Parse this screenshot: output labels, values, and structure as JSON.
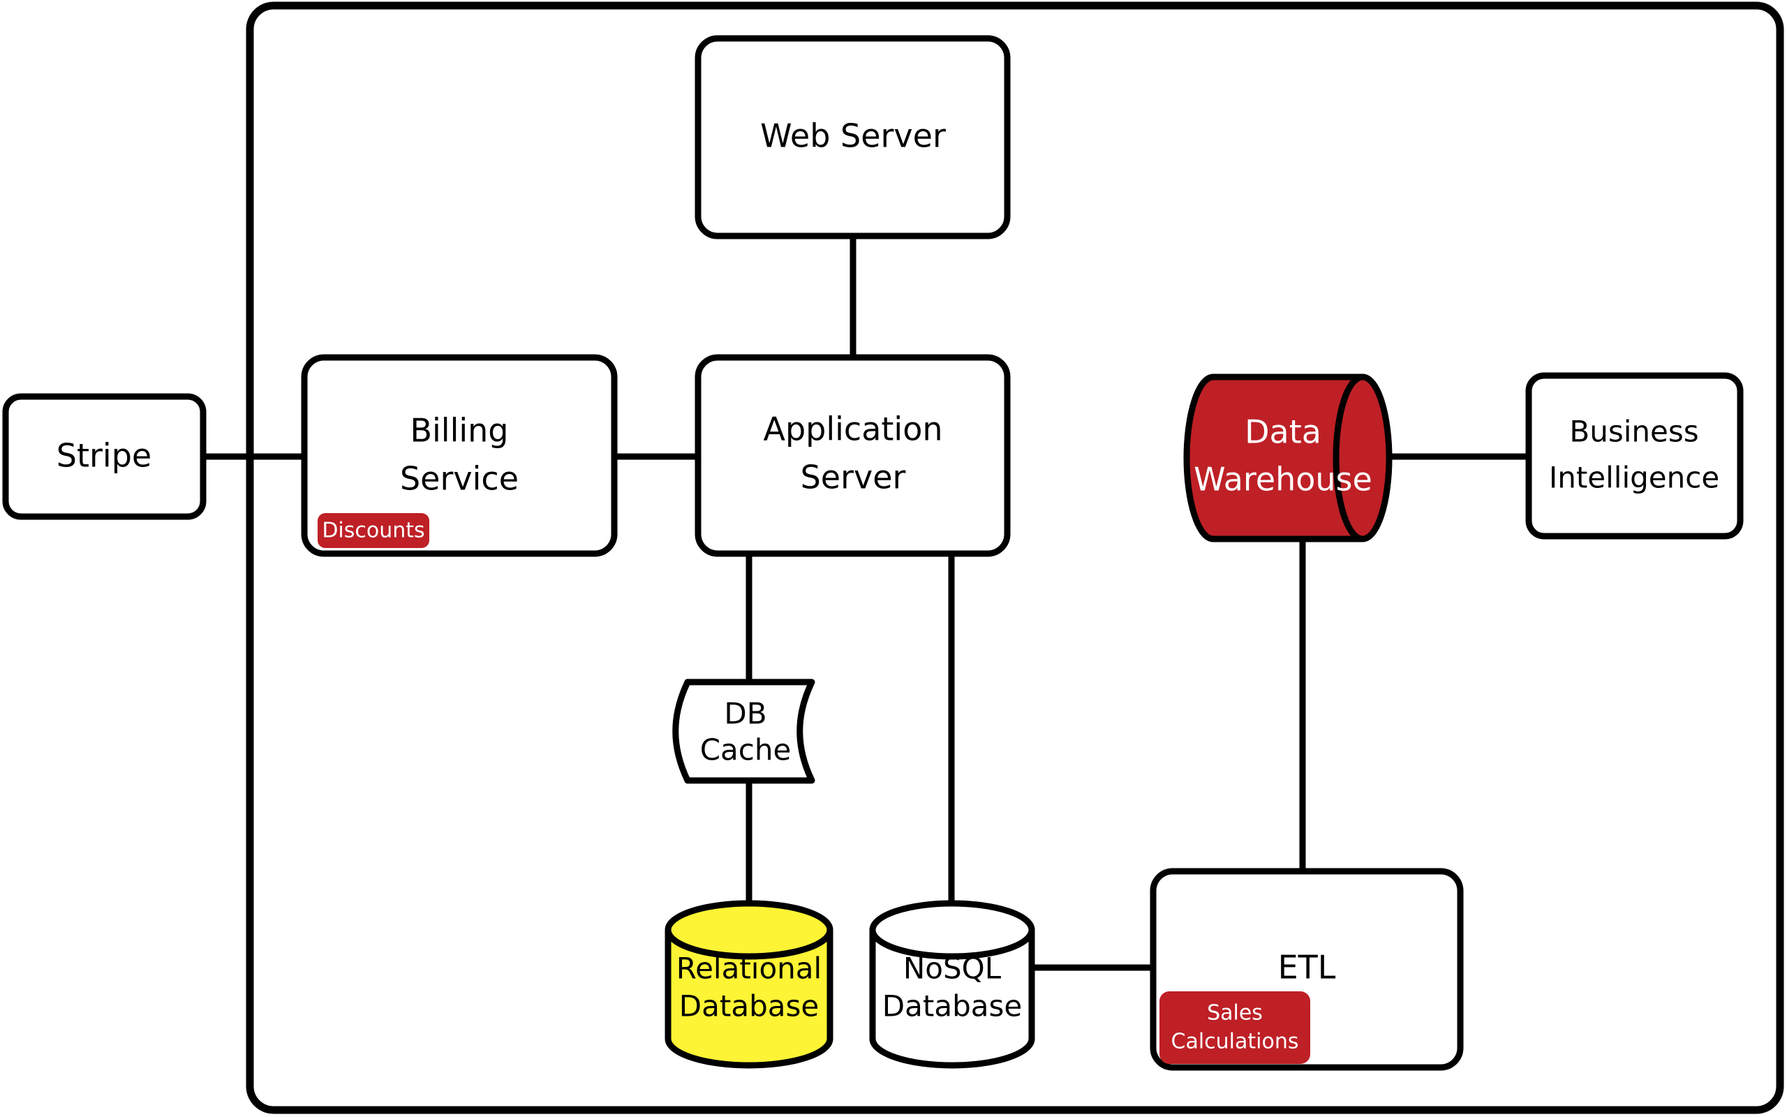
{
  "diagram": {
    "title": "System Architecture Diagram",
    "background_color": "#ffffff",
    "stroke_color": "#000000",
    "accent_red": "#BE2026",
    "accent_yellow": "#FCF434",
    "boundary": {
      "name": "system-boundary",
      "label": ""
    }
  },
  "nodes": {
    "stripe": {
      "label": "Stripe",
      "shape": "rounded-rect",
      "fill": "#ffffff"
    },
    "billing_service": {
      "label_line1": "Billing",
      "label_line2": "Service",
      "shape": "rounded-rect",
      "fill": "#ffffff"
    },
    "web_server": {
      "label": "Web Server",
      "shape": "rounded-rect",
      "fill": "#ffffff"
    },
    "application_server": {
      "label_line1": "Application",
      "label_line2": "Server",
      "shape": "rounded-rect",
      "fill": "#ffffff"
    },
    "db_cache": {
      "label_line1": "DB",
      "label_line2": "Cache",
      "shape": "document",
      "fill": "#ffffff"
    },
    "relational_database": {
      "label_line1": "Relational",
      "label_line2": "Database",
      "shape": "cylinder-vertical",
      "fill": "#FCF434"
    },
    "nosql_database": {
      "label_line1": "NoSQL",
      "label_line2": "Database",
      "shape": "cylinder-vertical",
      "fill": "#ffffff"
    },
    "etl": {
      "label": "ETL",
      "shape": "rounded-rect",
      "fill": "#ffffff"
    },
    "data_warehouse": {
      "label_line1": "Data",
      "label_line2": "Warehouse",
      "shape": "cylinder-horizontal",
      "fill": "#BE2026",
      "text_color": "#ffffff"
    },
    "business_intelligence": {
      "label_line1": "Business",
      "label_line2": "Intelligence",
      "shape": "rounded-rect",
      "fill": "#ffffff"
    }
  },
  "badges": {
    "discounts": {
      "label": "Discounts",
      "fill": "#BE2026",
      "text_color": "#ffffff",
      "attached_to": "billing_service"
    },
    "sales_calculations": {
      "label_line1": "Sales",
      "label_line2": "Calculations",
      "fill": "#BE2026",
      "text_color": "#ffffff",
      "attached_to": "etl"
    }
  },
  "connections": [
    {
      "from": "stripe",
      "to": "billing_service"
    },
    {
      "from": "billing_service",
      "to": "application_server"
    },
    {
      "from": "web_server",
      "to": "application_server"
    },
    {
      "from": "application_server",
      "to": "db_cache"
    },
    {
      "from": "db_cache",
      "to": "relational_database"
    },
    {
      "from": "application_server",
      "to": "nosql_database"
    },
    {
      "from": "nosql_database",
      "to": "etl"
    },
    {
      "from": "etl",
      "to": "data_warehouse"
    },
    {
      "from": "data_warehouse",
      "to": "business_intelligence"
    }
  ]
}
